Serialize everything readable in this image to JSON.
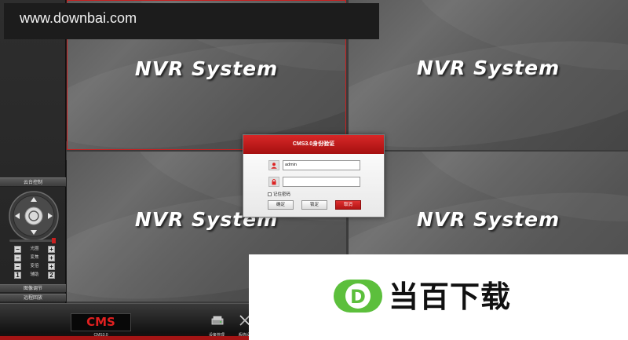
{
  "watermark": {
    "text": "www.downbai.com"
  },
  "channels": [
    {
      "title": "NVR System",
      "selected": true
    },
    {
      "title": "NVR System",
      "selected": false
    },
    {
      "title": "NVR System",
      "selected": false
    },
    {
      "title": "NVR System",
      "selected": false
    }
  ],
  "left_panel": {
    "ptz_header": "云台控制",
    "ptz_rows": [
      {
        "minus": "−",
        "label": "光圈",
        "plus": "+"
      },
      {
        "minus": "−",
        "label": "变焦",
        "plus": "+"
      },
      {
        "minus": "−",
        "label": "变倍",
        "plus": "+"
      },
      {
        "minus": "1",
        "label": "辅助",
        "plus": "2"
      }
    ],
    "sections": [
      "图像调节",
      "远程回放"
    ]
  },
  "dialog": {
    "title": "CMS3.0身份验证",
    "username_value": "admin",
    "password_value": "",
    "remember_label": "记住密码",
    "buttons": {
      "confirm": "确定",
      "lock": "锁定",
      "cancel": "取消"
    }
  },
  "bottom_bar": {
    "logo": "CMS",
    "version": "CMS3.0",
    "tools": [
      {
        "label": "设备管理",
        "icon": "device-manage-icon"
      },
      {
        "label": "系统设",
        "icon": "system-settings-icon"
      }
    ]
  },
  "brand": {
    "logo_letter": "D",
    "text": "当百下载",
    "accent": "#5cbf3c"
  },
  "colors": {
    "accent_red": "#c81f1f",
    "panel_bg": "#2a2a2a"
  }
}
